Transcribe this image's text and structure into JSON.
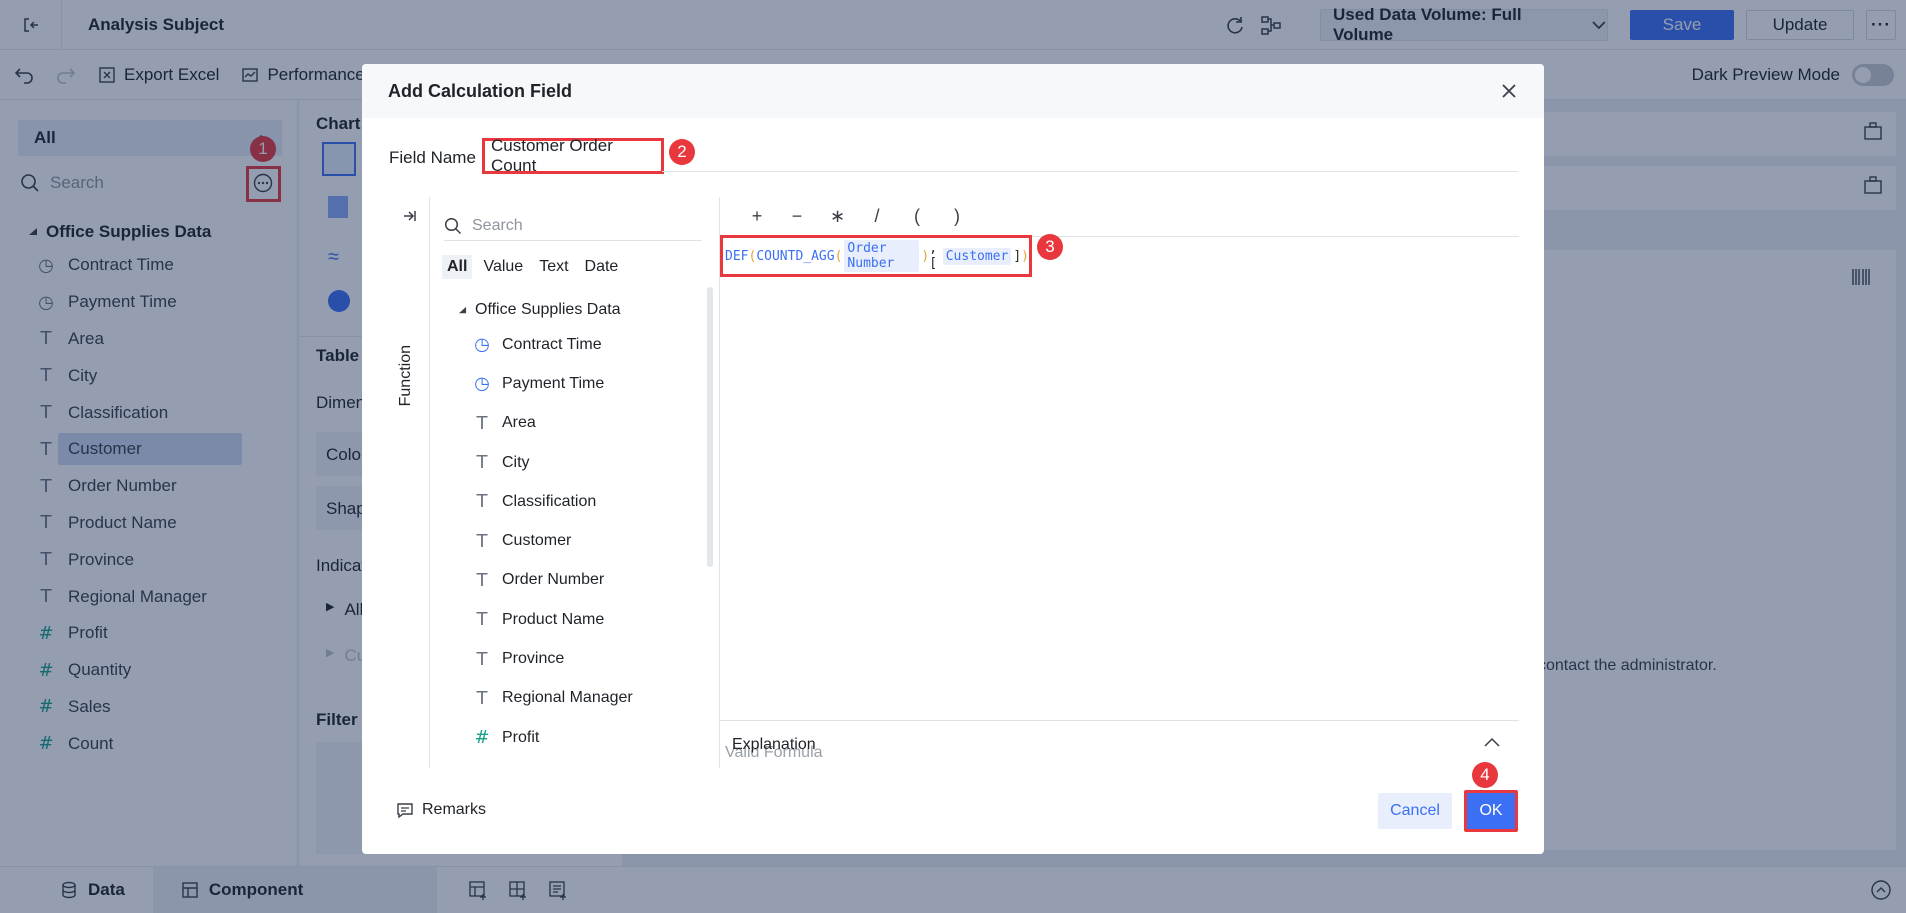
{
  "app": {
    "title": "Analysis Subject",
    "data_volume": "Used Data Volume: Full Volume",
    "save_label": "Save",
    "update_label": "Update",
    "export_label": "Export Excel",
    "performance_label": "Performance",
    "dark_mode_label": "Dark Preview Mode"
  },
  "left_panel": {
    "select_value": "All",
    "search_placeholder": "Search",
    "tree_root": "Office Supplies Data",
    "fields": [
      {
        "label": "Contract Time",
        "icon": "clock-icon"
      },
      {
        "label": "Payment Time",
        "icon": "clock-icon"
      },
      {
        "label": "Area",
        "icon": "text-icon"
      },
      {
        "label": "City",
        "icon": "text-icon"
      },
      {
        "label": "Classification",
        "icon": "text-icon"
      },
      {
        "label": "Customer",
        "icon": "text-icon"
      },
      {
        "label": "Order Number",
        "icon": "text-icon"
      },
      {
        "label": "Product Name",
        "icon": "text-icon"
      },
      {
        "label": "Province",
        "icon": "text-icon"
      },
      {
        "label": "Regional Manager",
        "icon": "text-icon"
      },
      {
        "label": "Profit",
        "icon": "number-icon"
      },
      {
        "label": "Quantity",
        "icon": "number-icon"
      },
      {
        "label": "Sales",
        "icon": "number-icon"
      },
      {
        "label": "Count",
        "icon": "number-icon"
      }
    ]
  },
  "mid_panel": {
    "chart_label": "Chart",
    "table_label": "Table",
    "dimension_label": "Dimen",
    "color_label": "Colo",
    "shape_label": "Shap",
    "indicator_label": "Indicat",
    "all_label": "All",
    "cu_label": "Cu",
    "filter_label": "Filter"
  },
  "canvas": {
    "message": "contact the administrator."
  },
  "bottom_bar": {
    "data_tab": "Data",
    "component_tab": "Component"
  },
  "dialog": {
    "title": "Add Calculation Field",
    "field_name_label": "Field Name",
    "field_name_value": "Customer Order Count",
    "function_label": "Function",
    "search_placeholder": "Search",
    "type_tabs": [
      "All",
      "Value",
      "Text",
      "Date"
    ],
    "tree_root": "Office Supplies Data",
    "fields": [
      {
        "label": "Contract Time",
        "icon": "clock-icon"
      },
      {
        "label": "Payment Time",
        "icon": "clock-icon"
      },
      {
        "label": "Area",
        "icon": "text-icon"
      },
      {
        "label": "City",
        "icon": "text-icon"
      },
      {
        "label": "Classification",
        "icon": "text-icon"
      },
      {
        "label": "Customer",
        "icon": "text-icon"
      },
      {
        "label": "Order Number",
        "icon": "text-icon"
      },
      {
        "label": "Product Name",
        "icon": "text-icon"
      },
      {
        "label": "Province",
        "icon": "text-icon"
      },
      {
        "label": "Regional Manager",
        "icon": "text-icon"
      },
      {
        "label": "Profit",
        "icon": "number-icon"
      }
    ],
    "operators": [
      "+",
      "−",
      "∗",
      "/",
      "(",
      ")"
    ],
    "formula": {
      "fn1": "DEF",
      "fn2": "COUNTD_AGG",
      "field1": "Order Number",
      "field2": "Customer"
    },
    "validity": "Valid Formula",
    "explanation_label": "Explanation",
    "remarks_label": "Remarks",
    "cancel_label": "Cancel",
    "ok_label": "OK"
  },
  "annotations": {
    "marker1": "1",
    "marker2": "2",
    "marker3": "3",
    "marker4": "4",
    "color": "#e8383d"
  }
}
